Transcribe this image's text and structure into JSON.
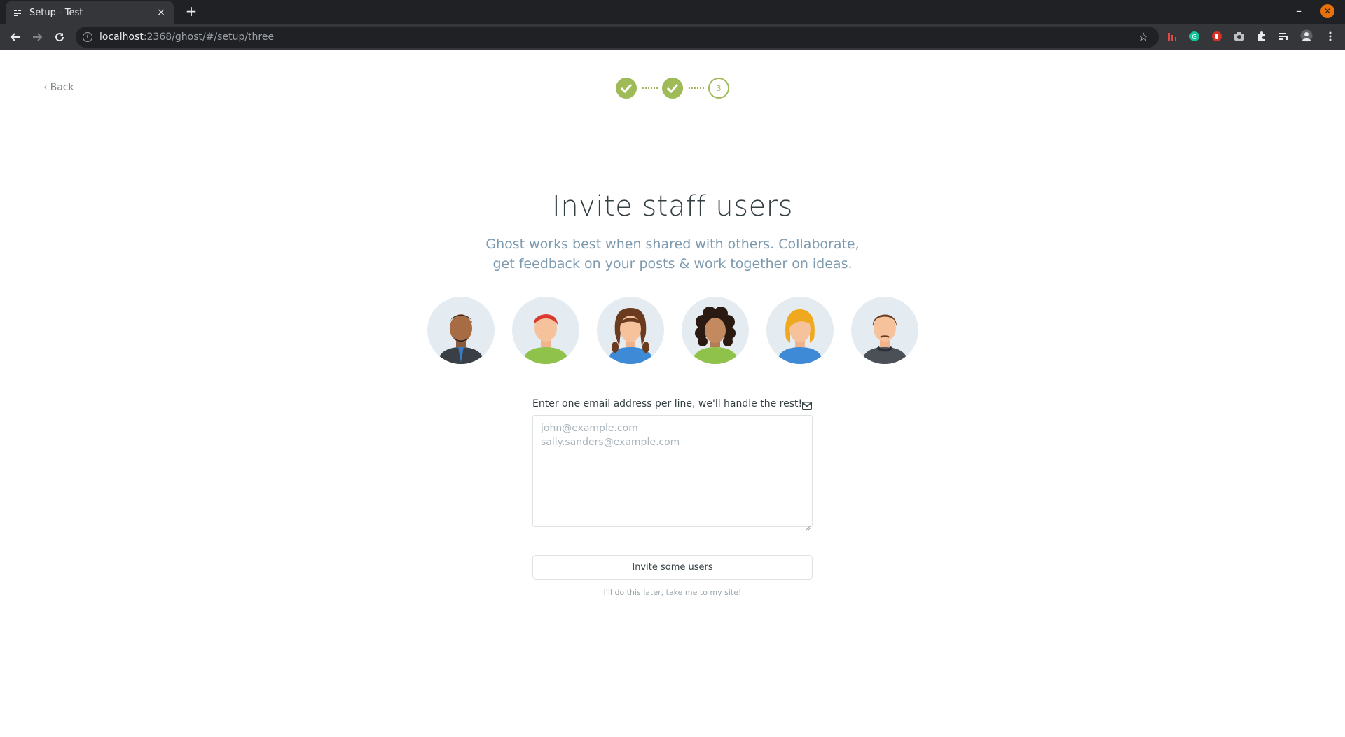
{
  "browser": {
    "tab_title": "Setup - Test",
    "tab_close": "×",
    "new_tab": "+",
    "url_host": "localhost",
    "url_rest": ":2368/ghost/#/setup/three",
    "minimize": "–",
    "close": "✕"
  },
  "page": {
    "back_label": "Back",
    "steps": [
      {
        "state": "done"
      },
      {
        "state": "done"
      },
      {
        "state": "current",
        "label": "3"
      }
    ],
    "title": "Invite staff users",
    "subtitle": "Ghost works best when shared with others. Collaborate, get feedback on your posts & work together on ideas.",
    "avatars": [
      "man-dark-beard",
      "man-red-hair",
      "woman-brown-pigtails",
      "woman-curly-hair",
      "woman-blonde",
      "man-brown-hair-sweater"
    ],
    "invite_field": {
      "label": "Enter one email address per line, we'll handle the rest!",
      "placeholder": "john@example.com\nsally.sanders@example.com",
      "value": ""
    },
    "invite_button": "Invite some users",
    "skip_link": "I'll do this later, take me to my site!"
  },
  "colors": {
    "accent": "#9fbb58",
    "title": "#343f44",
    "subtitle": "#7d9aaf"
  }
}
